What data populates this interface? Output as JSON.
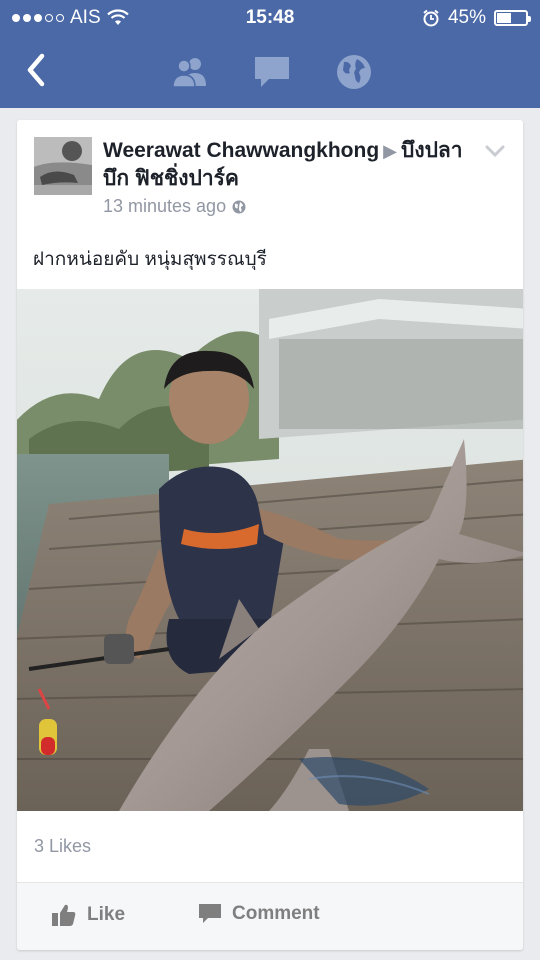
{
  "status_bar": {
    "carrier": "AIS",
    "time": "15:48",
    "battery": "45%",
    "battery_level": 0.45,
    "signal_bars": 3,
    "signal_total": 5
  },
  "nav": {
    "icons": [
      "back-chevron-icon",
      "friends-icon",
      "messages-icon",
      "globe-icon"
    ]
  },
  "post": {
    "author": "Weerawat Chawwangkhong",
    "place": "บึงปลาบึก ฟิชชิ่งปาร์ค",
    "timestamp": "13 minutes ago",
    "text": "ฝากหน่อยคับ หนุ่มสุพรรณบุรี",
    "likes": "3 Likes"
  },
  "actions": {
    "like": "Like",
    "comment": "Comment"
  },
  "colors": {
    "brand": "#4b69a6",
    "muted": "#9197a3"
  }
}
